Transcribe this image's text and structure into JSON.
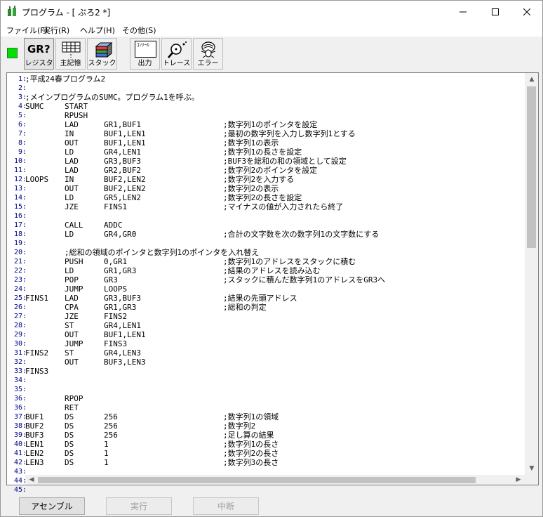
{
  "window": {
    "title": "プログラム - [ ぷろ2 *]"
  },
  "menu": [
    "ファイル(F)",
    "実行(R)",
    "ヘルプ(H)",
    "その他(S)"
  ],
  "toolbar": {
    "register_label": "レジスタ",
    "register_icon_text": "GR?",
    "memory_label": "主記憶",
    "stack_label": "スタック",
    "output_label": "出力",
    "output_icon_text": "ｺﾝｿｰﾙ",
    "trace_label": "トレース",
    "error_label": "エラー"
  },
  "status": {
    "led_color": "#00e000"
  },
  "code_lines": [
    {
      "n": "1",
      "c0": ";平成24春プログラム2",
      "c1": "",
      "c2": "",
      "c3": ""
    },
    {
      "n": "2",
      "c0": "",
      "c1": "",
      "c2": "",
      "c3": ""
    },
    {
      "n": "3",
      "c0": ";メインプログラムのSUMC。プログラム1を呼ぶ。",
      "c1": "",
      "c2": "",
      "c3": ""
    },
    {
      "n": "4",
      "c0": "SUMC",
      "c1": "START",
      "c2": "",
      "c3": ""
    },
    {
      "n": "5",
      "c0": "",
      "c1": "RPUSH",
      "c2": "",
      "c3": ""
    },
    {
      "n": "6",
      "c0": "",
      "c1": "LAD",
      "c2": "GR1,BUF1",
      "c3": ";数字列1のポインタを設定"
    },
    {
      "n": "7",
      "c0": "",
      "c1": "IN",
      "c2": "BUF1,LEN1",
      "c3": ";最初の数字列を入力し数字列1とする"
    },
    {
      "n": "8",
      "c0": "",
      "c1": "OUT",
      "c2": "BUF1,LEN1",
      "c3": ";数字列1の表示"
    },
    {
      "n": "9",
      "c0": "",
      "c1": "LD",
      "c2": "GR4,LEN1",
      "c3": ";数字列1の長さを設定"
    },
    {
      "n": "10",
      "c0": "",
      "c1": "LAD",
      "c2": "GR3,BUF3",
      "c3": ";BUF3を総和の和の領域として設定"
    },
    {
      "n": "11",
      "c0": "",
      "c1": "LAD",
      "c2": "GR2,BUF2",
      "c3": ";数字列2のポインタを設定"
    },
    {
      "n": "12",
      "c0": "LOOPS",
      "c1": "IN",
      "c2": "BUF2,LEN2",
      "c3": ";数字列2を入力する"
    },
    {
      "n": "13",
      "c0": "",
      "c1": "OUT",
      "c2": "BUF2,LEN2",
      "c3": ";数字列2の表示"
    },
    {
      "n": "14",
      "c0": "",
      "c1": "LD",
      "c2": "GR5,LEN2",
      "c3": ";数字列2の長さを設定"
    },
    {
      "n": "15",
      "c0": "",
      "c1": "JZE",
      "c2": "FINS1",
      "c3": ";マイナスの値が入力されたら終了"
    },
    {
      "n": "16",
      "c0": "",
      "c1": "",
      "c2": "",
      "c3": ""
    },
    {
      "n": "17",
      "c0": "",
      "c1": "CALL",
      "c2": "ADDC",
      "c3": ""
    },
    {
      "n": "18",
      "c0": "",
      "c1": "LD",
      "c2": "GR4,GR0",
      "c3": ";合計の文字数を次の数字列1の文字数にする"
    },
    {
      "n": "19",
      "c0": "",
      "c1": "",
      "c2": "",
      "c3": ""
    },
    {
      "n": "20",
      "c0": "",
      "c1": ";総和の領域のポインタと数字列1のポインタを入れ替え",
      "c2": "",
      "c3": ""
    },
    {
      "n": "21",
      "c0": "",
      "c1": "PUSH",
      "c2": "0,GR1",
      "c3": ";数字列1のアドレスをスタックに積む"
    },
    {
      "n": "22",
      "c0": "",
      "c1": "LD",
      "c2": "GR1,GR3",
      "c3": ";結果のアドレスを読み込む"
    },
    {
      "n": "23",
      "c0": "",
      "c1": "POP",
      "c2": "GR3",
      "c3": ";スタックに積んだ数字列1のアドレスをGR3へ"
    },
    {
      "n": "24",
      "c0": "",
      "c1": "JUMP",
      "c2": "LOOPS",
      "c3": ""
    },
    {
      "n": "25",
      "c0": "FINS1",
      "c1": "LAD",
      "c2": "GR3,BUF3",
      "c3": ";結果の先頭アドレス"
    },
    {
      "n": "26",
      "c0": "",
      "c1": "CPA",
      "c2": "GR1,GR3",
      "c3": ";総和の判定"
    },
    {
      "n": "27",
      "c0": "",
      "c1": "JZE",
      "c2": "FINS2",
      "c3": ""
    },
    {
      "n": "28",
      "c0": "",
      "c1": "ST",
      "c2": "GR4,LEN1",
      "c3": ""
    },
    {
      "n": "29",
      "c0": "",
      "c1": "OUT",
      "c2": "BUF1,LEN1",
      "c3": ""
    },
    {
      "n": "30",
      "c0": "",
      "c1": "JUMP",
      "c2": "FINS3",
      "c3": ""
    },
    {
      "n": "31",
      "c0": "FINS2",
      "c1": "ST",
      "c2": "GR4,LEN3",
      "c3": ""
    },
    {
      "n": "32",
      "c0": "",
      "c1": "OUT",
      "c2": "BUF3,LEN3",
      "c3": ""
    },
    {
      "n": "33",
      "c0": "FINS3",
      "c1": "",
      "c2": "",
      "c3": ""
    },
    {
      "n": "34",
      "c0": "",
      "c1": "",
      "c2": "",
      "c3": ""
    },
    {
      "n": "35",
      "c0": "",
      "c1": "",
      "c2": "",
      "c3": ""
    },
    {
      "n": "36",
      "c0": "",
      "c1": "RPOP",
      "c2": "",
      "c3": ""
    },
    {
      "n": "36",
      "c0": "",
      "c1": "RET",
      "c2": "",
      "c3": ""
    },
    {
      "n": "37",
      "c0": "BUF1",
      "c1": "DS",
      "c2": "256",
      "c3": ";数字列1の領域"
    },
    {
      "n": "38",
      "c0": "BUF2",
      "c1": "DS",
      "c2": "256",
      "c3": ";数字列2"
    },
    {
      "n": "39",
      "c0": "BUF3",
      "c1": "DS",
      "c2": "256",
      "c3": ";足し算の結果"
    },
    {
      "n": "40",
      "c0": "LEN1",
      "c1": "DS",
      "c2": "1",
      "c3": ";数字列1の長さ"
    },
    {
      "n": "41",
      "c0": "LEN2",
      "c1": "DS",
      "c2": "1",
      "c3": ";数字列2の長さ"
    },
    {
      "n": "42",
      "c0": "LEN3",
      "c1": "DS",
      "c2": "1",
      "c3": ";数字列3の長さ"
    },
    {
      "n": "43",
      "c0": "",
      "c1": "",
      "c2": "",
      "c3": ""
    },
    {
      "n": "44",
      "c0": "",
      "c1": "",
      "c2": "",
      "c3": ""
    },
    {
      "n": "45",
      "c0": "",
      "c1": "",
      "c2": "",
      "c3": ""
    }
  ],
  "buttons": {
    "assemble": "アセンブル",
    "run": "実行",
    "stop": "中断"
  },
  "separator": ":"
}
